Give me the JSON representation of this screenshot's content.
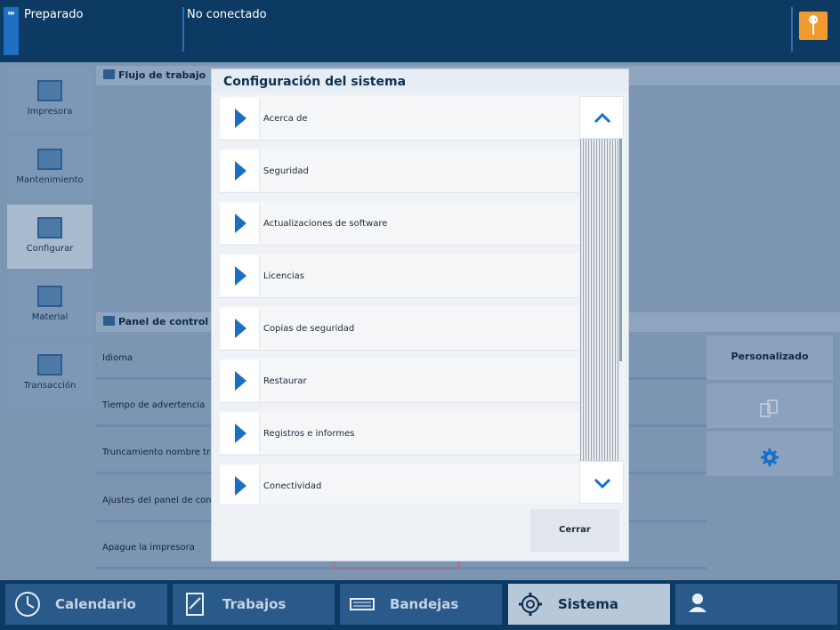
{
  "topbar": {
    "status": "Preparado",
    "connection": "No conectado",
    "wrench_icon": "wrench-icon",
    "accent": "#f29a2e"
  },
  "sidebar": {
    "items": [
      {
        "label": "Impresora",
        "icon": "printer-icon"
      },
      {
        "label": "Mantenimiento",
        "icon": "maintenance-icon"
      },
      {
        "label": "Configurar",
        "icon": "configure-icon"
      },
      {
        "label": "Material",
        "icon": "material-icon"
      },
      {
        "label": "Transacción",
        "icon": "transaction-icon"
      }
    ]
  },
  "sections": {
    "workflow": "Flujo de trabajo",
    "control_panel": "Panel de control"
  },
  "rows": [
    {
      "label": "Idioma",
      "button": "Personalizado"
    },
    {
      "label": "Tiempo de advertencia"
    },
    {
      "label": "Truncamiento nombre traba"
    },
    {
      "label": "Ajustes del panel de control"
    },
    {
      "label": "Apague la impresora"
    }
  ],
  "dialog": {
    "title": "Configuración del sistema",
    "items": [
      {
        "label": "Acerca de"
      },
      {
        "label": "Seguridad"
      },
      {
        "label": "Actualizaciones de software"
      },
      {
        "label": "Licencias"
      },
      {
        "label": "Copias de seguridad"
      },
      {
        "label": "Restaurar"
      },
      {
        "label": "Registros e informes"
      },
      {
        "label": "Conectividad"
      }
    ],
    "close_label": "Cerrar"
  },
  "bottom_tabs": [
    {
      "label": "Calendario",
      "icon": "clock-icon"
    },
    {
      "label": "Trabajos",
      "icon": "document-icon"
    },
    {
      "label": "Bandejas",
      "icon": "tray-icon"
    },
    {
      "label": "Sistema",
      "icon": "gear-icon",
      "active": true
    },
    {
      "label": "",
      "icon": "user-key-icon"
    }
  ]
}
